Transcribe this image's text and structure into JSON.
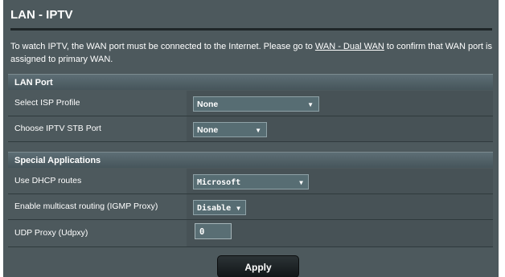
{
  "page": {
    "title": "LAN - IPTV",
    "info_before_link": "To watch IPTV, the WAN port must be connected to the Internet. Please go to ",
    "info_link": "WAN - Dual WAN",
    "info_after_link": " to confirm that WAN port is assigned to primary WAN."
  },
  "lan_port": {
    "heading": "LAN Port",
    "isp_profile": {
      "label": "Select ISP Profile",
      "value": "None"
    },
    "stb_port": {
      "label": "Choose IPTV STB Port",
      "value": "None"
    }
  },
  "special": {
    "heading": "Special Applications",
    "dhcp_routes": {
      "label": "Use DHCP routes",
      "value": "Microsoft"
    },
    "igmp_proxy": {
      "label": "Enable multicast routing (IGMP Proxy)",
      "value": "Disable"
    },
    "udpxy": {
      "label": "UDP Proxy (Udpxy)",
      "value": "0"
    }
  },
  "actions": {
    "apply_label": "Apply"
  },
  "icons": {
    "dropdown": "chevron-down-icon"
  },
  "colors": {
    "panel_bg": "#4d595d",
    "value_bg": "#475256",
    "button_bg": "#1c2224"
  }
}
